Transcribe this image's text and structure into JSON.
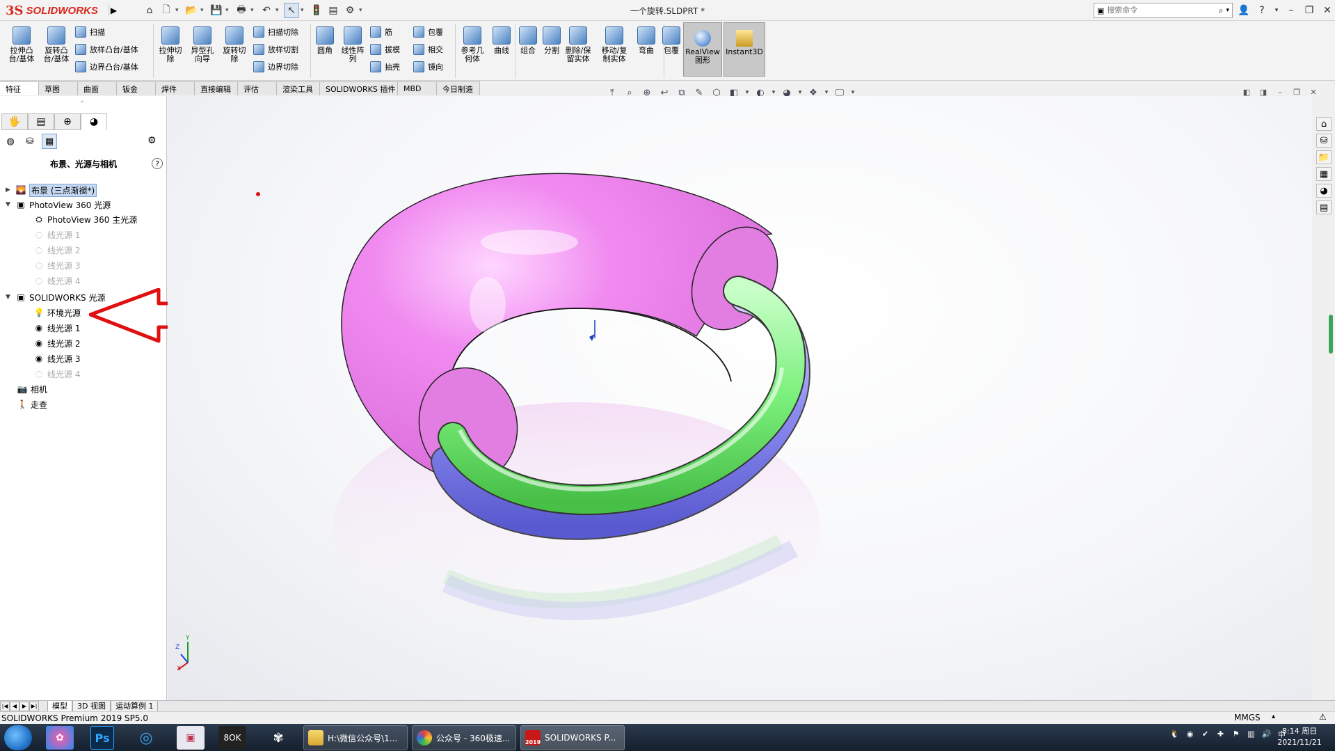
{
  "app": {
    "brand_ds": "3S",
    "brand_name": "SOLIDWORKS",
    "document_title": "一个旋转.SLDPRT *",
    "search_placeholder": "搜索命令"
  },
  "commands": {
    "extrude_boss": "拉伸凸\n台/基体",
    "revolve_boss": "旋转凸\n台/基体",
    "sweep": "扫描",
    "loft_boss": "放样凸台/基体",
    "boundary_boss": "边界凸台/基体",
    "extrude_cut": "拉伸切\n除",
    "hole_wizard": "异型孔\n向导",
    "revolve_cut": "旋转切\n除",
    "swept_cut": "扫描切除",
    "lofted_cut": "放样切割",
    "boundary_cut": "边界切除",
    "fillet": "圆角",
    "linear_pattern": "线性阵\n列",
    "rib": "筋",
    "draft": "拔模",
    "shell": "抽壳",
    "wrap": "包覆",
    "intersect": "相交",
    "mirror": "镜向",
    "reference_geometry": "参考几\n何体",
    "curves": "曲线",
    "combine": "组合",
    "split": "分割",
    "delete_keep_body": "删除/保\n留实体",
    "move_copy_body": "移动/复\n制实体",
    "flex": "弯曲",
    "wrap2": "包覆",
    "realview": "RealView\n图形",
    "instant3d": "Instant3D"
  },
  "tabs": [
    "特征",
    "草图",
    "曲面",
    "钣金",
    "焊件",
    "直接编辑",
    "评估",
    "渲染工具",
    "SOLIDWORKS 插件",
    "MBD",
    "今日制造"
  ],
  "panel": {
    "title": "布景、光源与相机",
    "help": "?",
    "tree": {
      "scene": "布景 (三点渐褪*)",
      "photoview_group": "PhotoView 360 光源",
      "photoview_main": "PhotoView 360 主光源",
      "pv_line1": "线光源 1",
      "pv_line2": "线光源 2",
      "pv_line3": "线光源 3",
      "pv_line4": "线光源 4",
      "sw_group": "SOLIDWORKS 光源",
      "ambient": "环境光源",
      "sw_line1": "线光源 1",
      "sw_line2": "线光源 2",
      "sw_line3": "线光源 3",
      "sw_line4": "线光源 4",
      "camera": "相机",
      "walkthrough": "走查"
    }
  },
  "bottom_tabs": [
    "模型",
    "3D 视图",
    "运动算例 1"
  ],
  "status": {
    "product": "SOLIDWORKS Premium 2019 SP5.0",
    "units": "MMGS"
  },
  "taskbar": {
    "win_folder": "H:\\微信公众号\\1...",
    "win_browser": "公众号 - 360极速...",
    "win_sw": "SOLIDWORKS P...",
    "sw_year": "2019",
    "time": "8:14 周日",
    "date": "2021/11/21"
  },
  "triad": {
    "y": "Y",
    "z": "Z",
    "x": "X"
  },
  "colors": {
    "torus": "#ee82ee",
    "green_tube": "#7cf07c",
    "blue_tube": "#8c8cf0",
    "annotation_arrow": "#e01010",
    "accent": "#d9261c"
  }
}
